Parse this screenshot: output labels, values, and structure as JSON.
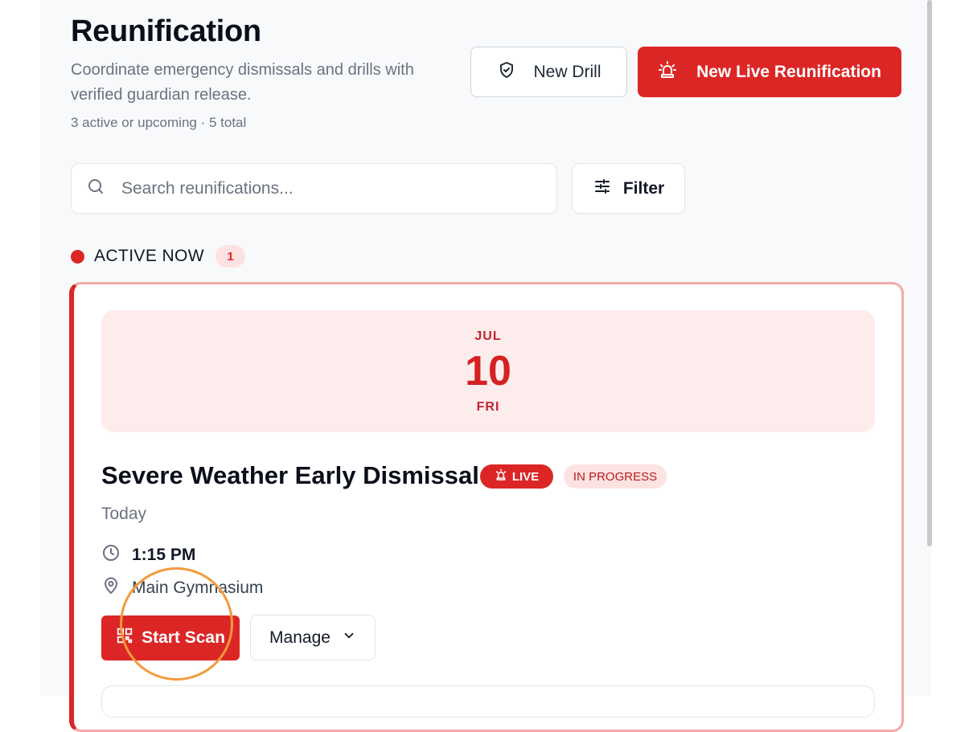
{
  "header": {
    "title": "Reunification",
    "subtitle": "Coordinate emergency dismissals and drills with verified guardian release.",
    "meta": "3 active or upcoming · 5 total"
  },
  "actions": {
    "new_drill_label": "New Drill",
    "new_live_label": "New Live Reunification"
  },
  "search": {
    "placeholder": "Search reunifications...",
    "value": ""
  },
  "filter": {
    "label": "Filter"
  },
  "section": {
    "label": "ACTIVE NOW",
    "count": "1"
  },
  "event": {
    "date": {
      "month": "JUL",
      "day": "10",
      "weekday": "FRI"
    },
    "title": "Severe Weather Early Dismissal",
    "live_badge": "LIVE",
    "status_badge": "IN PROGRESS",
    "when": "Today",
    "time": "1:15 PM",
    "location": "Main Gymnasium",
    "start_scan_label": "Start Scan",
    "manage_label": "Manage"
  },
  "colors": {
    "accent": "#dc2626",
    "accent_soft": "#fdecec",
    "cursor_highlight": "#f39a3c"
  },
  "icons": {
    "drill": "shield-check-icon",
    "live": "siren-icon",
    "search": "search-icon",
    "filter": "sliders-icon",
    "time": "clock-icon",
    "location": "map-pin-icon",
    "scan": "qr-code-icon",
    "manage": "chevron-down-icon"
  }
}
